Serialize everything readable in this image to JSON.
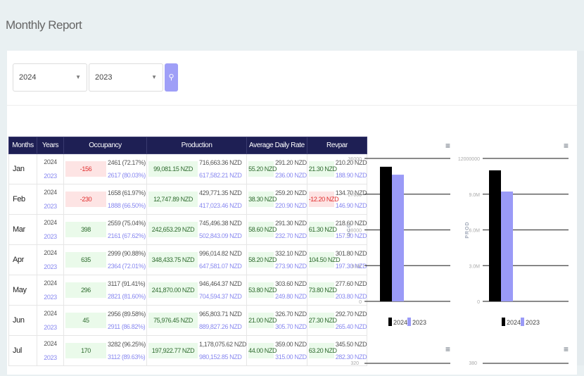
{
  "title": "Monthly Report",
  "filters": {
    "year1": "2024",
    "year2": "2023",
    "search_icon": "search-icon"
  },
  "table": {
    "headers": [
      "Months",
      "Years",
      "Occupancy",
      "Production",
      "Average Daily Rate",
      "Revpar"
    ],
    "rows": [
      {
        "month": "Jan",
        "y1": "2024",
        "y2": "2023",
        "occ_diff": "-156",
        "occ1": "2461 (72.17%)",
        "occ2": "2617 (80.03%)",
        "prod_diff": "99,081.15 NZD",
        "prod1": "716,663.36 NZD",
        "prod2": "617,582.21 NZD",
        "adr_diff": "55.20 NZD",
        "adr1": "291.20 NZD",
        "adr2": "236.00 NZD",
        "rev_diff": "21.30 NZD",
        "rev1": "210.20 NZD",
        "rev2": "188.90 NZD"
      },
      {
        "month": "Feb",
        "y1": "2024",
        "y2": "2023",
        "occ_diff": "-230",
        "occ1": "1658 (61.97%)",
        "occ2": "1888 (66.50%)",
        "prod_diff": "12,747.89 NZD",
        "prod1": "429,771.35 NZD",
        "prod2": "417,023.46 NZD",
        "adr_diff": "38.30 NZD",
        "adr1": "259.20 NZD",
        "adr2": "220.90 NZD",
        "rev_diff": "-12.20 NZD",
        "rev1": "134.70 NZD",
        "rev2": "146.90 NZD"
      },
      {
        "month": "Mar",
        "y1": "2024",
        "y2": "2023",
        "occ_diff": "398",
        "occ1": "2559 (75.04%)",
        "occ2": "2161 (67.62%)",
        "prod_diff": "242,653.29 NZD",
        "prod1": "745,496.38 NZD",
        "prod2": "502,843.09 NZD",
        "adr_diff": "58.60 NZD",
        "adr1": "291.30 NZD",
        "adr2": "232.70 NZD",
        "rev_diff": "61.30 NZD",
        "rev1": "218.60 NZD",
        "rev2": "157.30 NZD"
      },
      {
        "month": "Apr",
        "y1": "2024",
        "y2": "2023",
        "occ_diff": "635",
        "occ1": "2999 (90.88%)",
        "occ2": "2364 (72.01%)",
        "prod_diff": "348,433.75 NZD",
        "prod1": "996,014.82 NZD",
        "prod2": "647,581.07 NZD",
        "adr_diff": "58.20 NZD",
        "adr1": "332.10 NZD",
        "adr2": "273.90 NZD",
        "rev_diff": "104.50 NZD",
        "rev1": "301.80 NZD",
        "rev2": "197.30 NZD"
      },
      {
        "month": "May",
        "y1": "2024",
        "y2": "2023",
        "occ_diff": "296",
        "occ1": "3117 (91.41%)",
        "occ2": "2821 (81.60%)",
        "prod_diff": "241,870.00 NZD",
        "prod1": "946,464.37 NZD",
        "prod2": "704,594.37 NZD",
        "adr_diff": "53.80 NZD",
        "adr1": "303.60 NZD",
        "adr2": "249.80 NZD",
        "rev_diff": "73.80 NZD",
        "rev1": "277.60 NZD",
        "rev2": "203.80 NZD"
      },
      {
        "month": "Jun",
        "y1": "2024",
        "y2": "2023",
        "occ_diff": "45",
        "occ1": "2956 (89.58%)",
        "occ2": "2911 (86.82%)",
        "prod_diff": "75,976.45 NZD",
        "prod1": "965,803.71 NZD",
        "prod2": "889,827.26 NZD",
        "adr_diff": "21.00 NZD",
        "adr1": "326.70 NZD",
        "adr2": "305.70 NZD",
        "rev_diff": "27.30 NZD",
        "rev1": "292.70 NZD",
        "rev2": "265.40 NZD"
      },
      {
        "month": "Jul",
        "y1": "2024",
        "y2": "2023",
        "occ_diff": "170",
        "occ1": "3282 (96.25%)",
        "occ2": "3112 (89.63%)",
        "prod_diff": "197,922.77 NZD",
        "prod1": "1,178,075.62 NZD",
        "prod2": "980,152.85 NZD",
        "adr_diff": "44.00 NZD",
        "adr1": "359.00 NZD",
        "adr2": "315.00 NZD",
        "rev_diff": "63.20 NZD",
        "rev1": "345.50 NZD",
        "rev2": "282.30 NZD"
      }
    ]
  },
  "colors": {
    "y2024": "#000000",
    "y2023": "#9a9af7",
    "neg": "#e02b2b",
    "pos": "#2f6b2f"
  },
  "chart_data": [
    {
      "type": "bar",
      "ylabel": "OCC",
      "categories": [
        ""
      ],
      "series": [
        {
          "name": "2024",
          "values": [
            33900
          ]
        },
        {
          "name": "2023",
          "values": [
            31900
          ]
        }
      ],
      "yticks": [
        "0",
        "9.0K",
        "18000",
        "27000",
        "36000"
      ],
      "ylim": [
        0,
        36000
      ],
      "legend": "bottom"
    },
    {
      "type": "bar",
      "ylabel": "PROD",
      "categories": [
        ""
      ],
      "series": [
        {
          "name": "2024",
          "values": [
            11000000
          ]
        },
        {
          "name": "2023",
          "values": [
            9220000
          ]
        }
      ],
      "yticks": [
        "0",
        "3.0M",
        "6.0M",
        "9.0M",
        "12000000"
      ],
      "ylim": [
        0,
        12000000
      ],
      "legend": "bottom"
    },
    {
      "type": "bar",
      "partial": true,
      "yticks": [
        "320"
      ]
    },
    {
      "type": "bar",
      "partial": true,
      "yticks": [
        "380"
      ]
    }
  ]
}
